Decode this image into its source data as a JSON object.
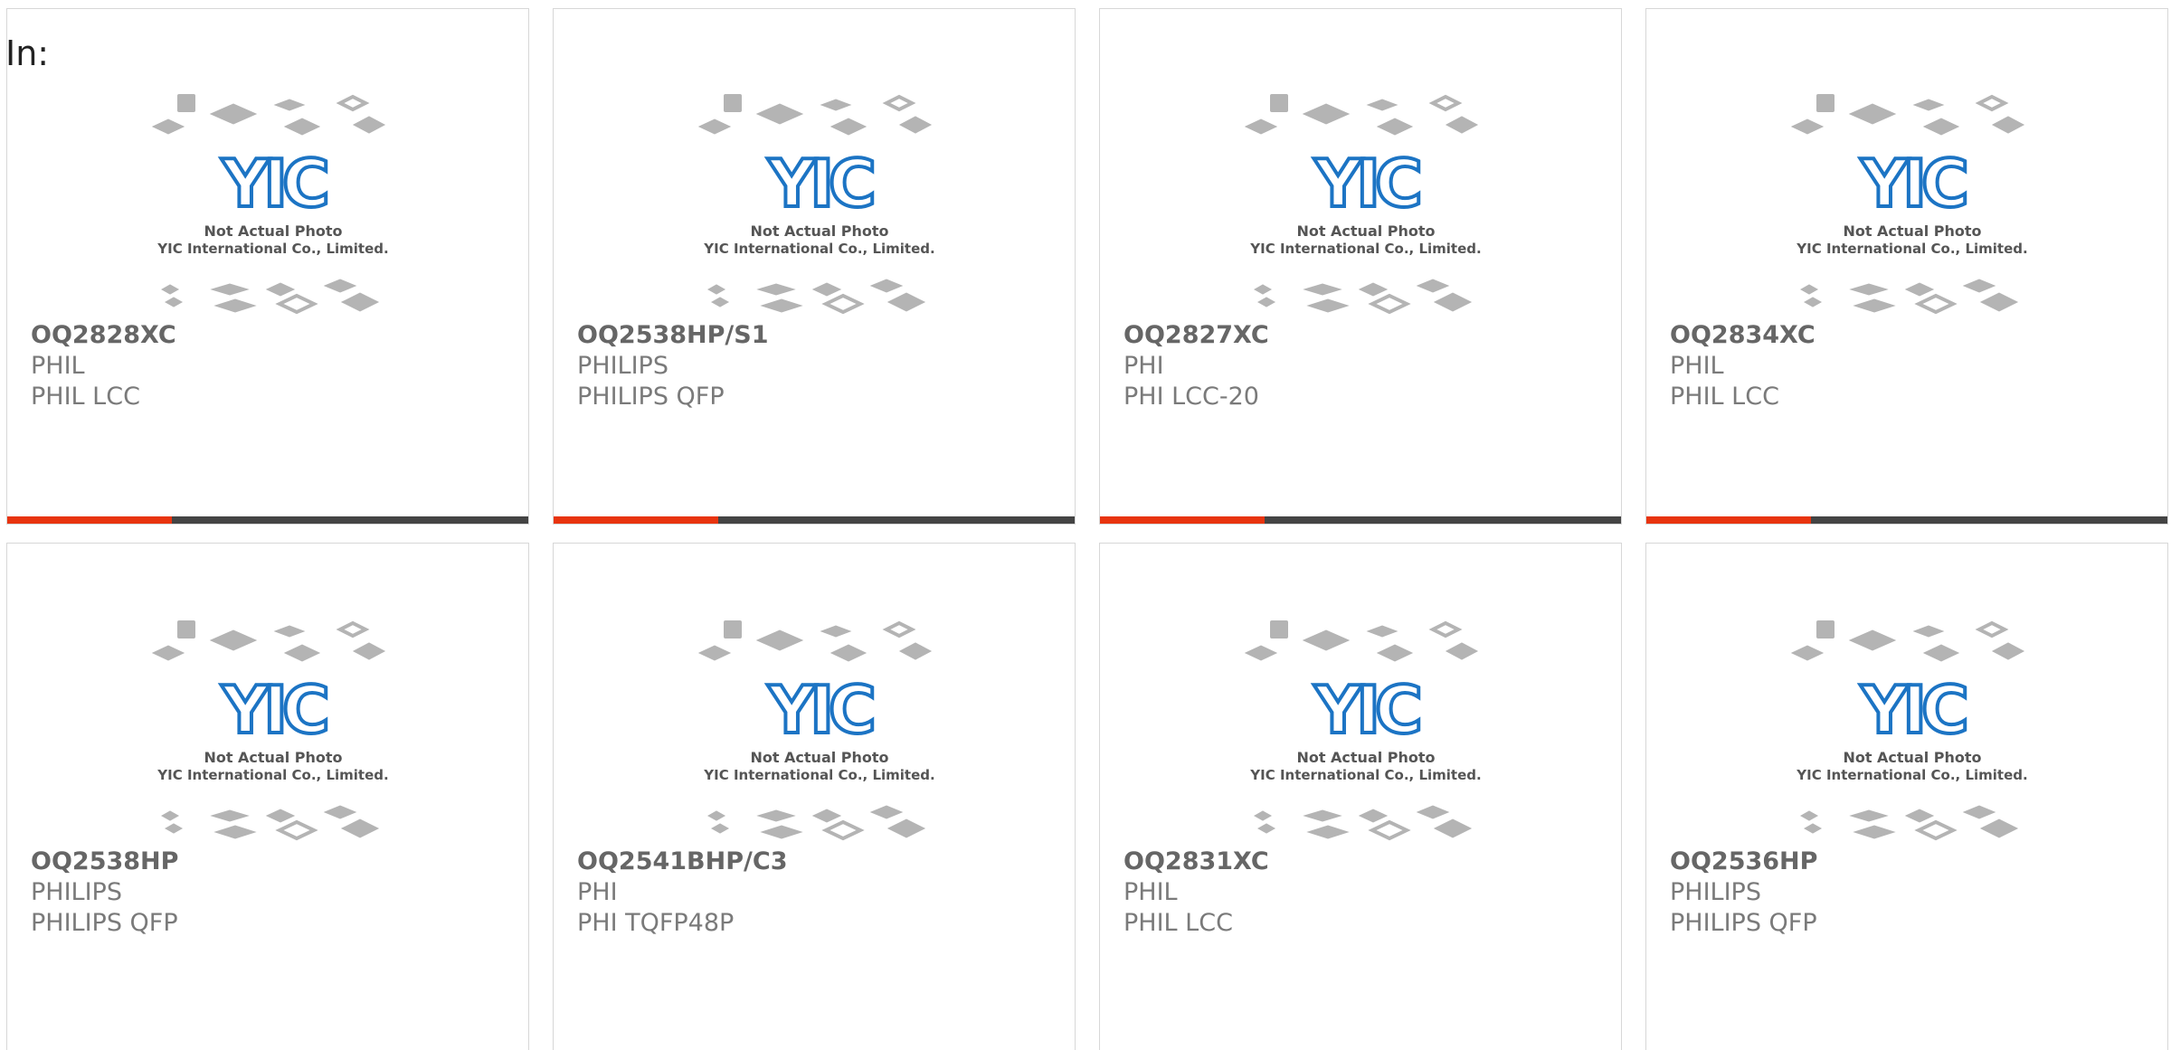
{
  "page": {
    "prefix_label": "In:"
  },
  "placeholder_photo": {
    "logo_text": "YIC",
    "line1": "Not Actual Photo",
    "line2": "YIC International Co., Limited."
  },
  "colors": {
    "accent": "#e8340f",
    "bar": "#444444",
    "logo_blue": "#1c74c4",
    "chip_gray": "#b4b4b4"
  },
  "products": [
    {
      "part": "OQ2828XC",
      "manufacturer": "PHIL",
      "package": "PHIL LCC"
    },
    {
      "part": "OQ2538HP/S1",
      "manufacturer": "PHILIPS",
      "package": "PHILIPS QFP"
    },
    {
      "part": "OQ2827XC",
      "manufacturer": "PHI",
      "package": "PHI LCC-20"
    },
    {
      "part": "OQ2834XC",
      "manufacturer": "PHIL",
      "package": "PHIL LCC"
    },
    {
      "part": "OQ2538HP",
      "manufacturer": "PHILIPS",
      "package": "PHILIPS QFP"
    },
    {
      "part": "OQ2541BHP/C3",
      "manufacturer": "PHI",
      "package": "PHI TQFP48P"
    },
    {
      "part": "OQ2831XC",
      "manufacturer": "PHIL",
      "package": "PHIL LCC"
    },
    {
      "part": "OQ2536HP",
      "manufacturer": "PHILIPS",
      "package": "PHILIPS QFP"
    }
  ]
}
